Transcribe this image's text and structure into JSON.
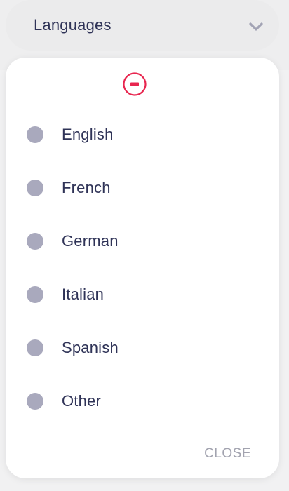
{
  "dropdown": {
    "label": "Languages",
    "icon": "chevron-down-icon"
  },
  "panel": {
    "collapse_icon": "minus-circle-icon",
    "options": [
      {
        "label": "English"
      },
      {
        "label": "French"
      },
      {
        "label": "German"
      },
      {
        "label": "Italian"
      },
      {
        "label": "Spanish"
      },
      {
        "label": "Other"
      }
    ],
    "close_label": "CLOSE"
  },
  "colors": {
    "text": "#2f3357",
    "radio": "#a9a9bd",
    "accent": "#e8264f",
    "muted": "#a2a3af"
  }
}
